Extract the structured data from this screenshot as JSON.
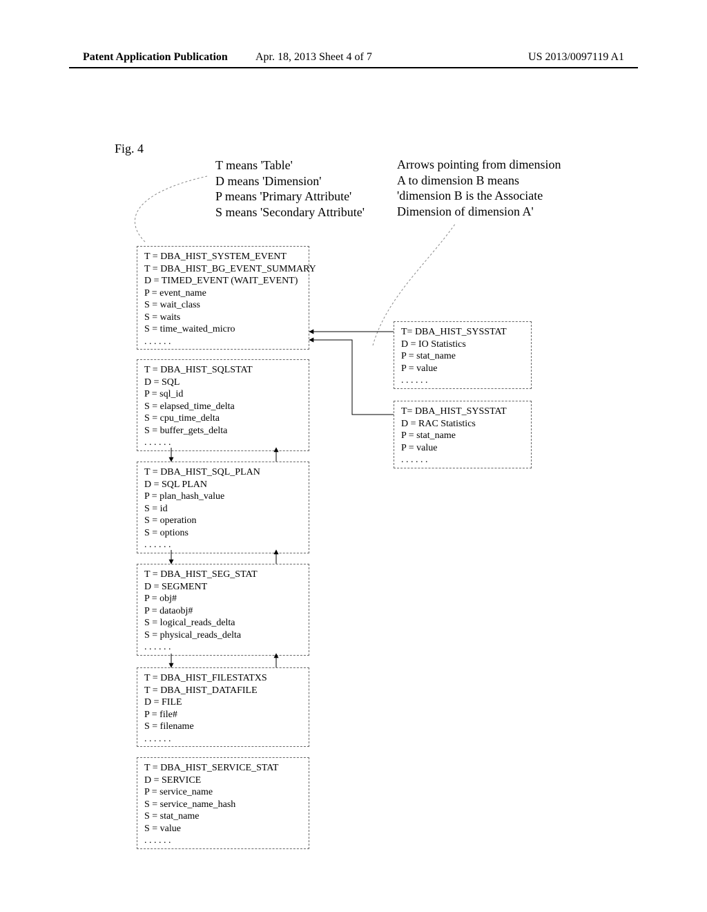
{
  "header": {
    "left": "Patent Application Publication",
    "date": "Apr. 18, 2013  Sheet 4 of 7",
    "right": "US 2013/0097119 A1"
  },
  "figure_label": "Fig. 4",
  "legend": {
    "l1": "T means 'Table'",
    "l2": "D means 'Dimension'",
    "l3": "P means 'Primary Attribute'",
    "l4": "S means 'Secondary Attribute'",
    "r1": "Arrows pointing from dimension",
    "r2": "A to dimension B means",
    "r3": "'dimension B is the Associate",
    "r4": "Dimension of dimension A'"
  },
  "box1": {
    "l1": "T = DBA_HIST_SYSTEM_EVENT",
    "l2": "T = DBA_HIST_BG_EVENT_SUMMARY",
    "l3": "D = TIMED_EVENT (WAIT_EVENT)",
    "l4": "P = event_name",
    "l5": "S = wait_class",
    "l6": "S = waits",
    "l7": "S = time_waited_micro",
    "l8": ". . . . . ."
  },
  "box2": {
    "l1": "T = DBA_HIST_SQLSTAT",
    "l2": "D = SQL",
    "l3": "P = sql_id",
    "l4": "S = elapsed_time_delta",
    "l5": "S = cpu_time_delta",
    "l6": "S = buffer_gets_delta",
    "l7": ". . . . . ."
  },
  "box3": {
    "l1": "T = DBA_HIST_SQL_PLAN",
    "l2": "D = SQL PLAN",
    "l3": "P = plan_hash_value",
    "l4": "S = id",
    "l5": "S = operation",
    "l6": "S = options",
    "l7": ". . . . . ."
  },
  "box4": {
    "l1": "T = DBA_HIST_SEG_STAT",
    "l2": "D = SEGMENT",
    "l3": "P = obj#",
    "l4": "P = dataobj#",
    "l5": "S = logical_reads_delta",
    "l6": "S = physical_reads_delta",
    "l7": ". . . . . ."
  },
  "box5": {
    "l1": "T = DBA_HIST_FILESTATXS",
    "l2": "T = DBA_HIST_DATAFILE",
    "l3": "D = FILE",
    "l4": "P = file#",
    "l5": "S = filename",
    "l6": ". . . . . ."
  },
  "box6": {
    "l1": "T = DBA_HIST_SERVICE_STAT",
    "l2": "D = SERVICE",
    "l3": "P = service_name",
    "l4": "S = service_name_hash",
    "l5": "S = stat_name",
    "l6": "S = value",
    "l7": ". . . . . ."
  },
  "box7": {
    "l1": "T= DBA_HIST_SYSSTAT",
    "l2": "D = IO Statistics",
    "l3": "P = stat_name",
    "l4": "P = value",
    "l5": ". . . . . ."
  },
  "box8": {
    "l1": "T= DBA_HIST_SYSSTAT",
    "l2": "D = RAC Statistics",
    "l3": "P = stat_name",
    "l4": "P = value",
    "l5": ". . . . . ."
  }
}
